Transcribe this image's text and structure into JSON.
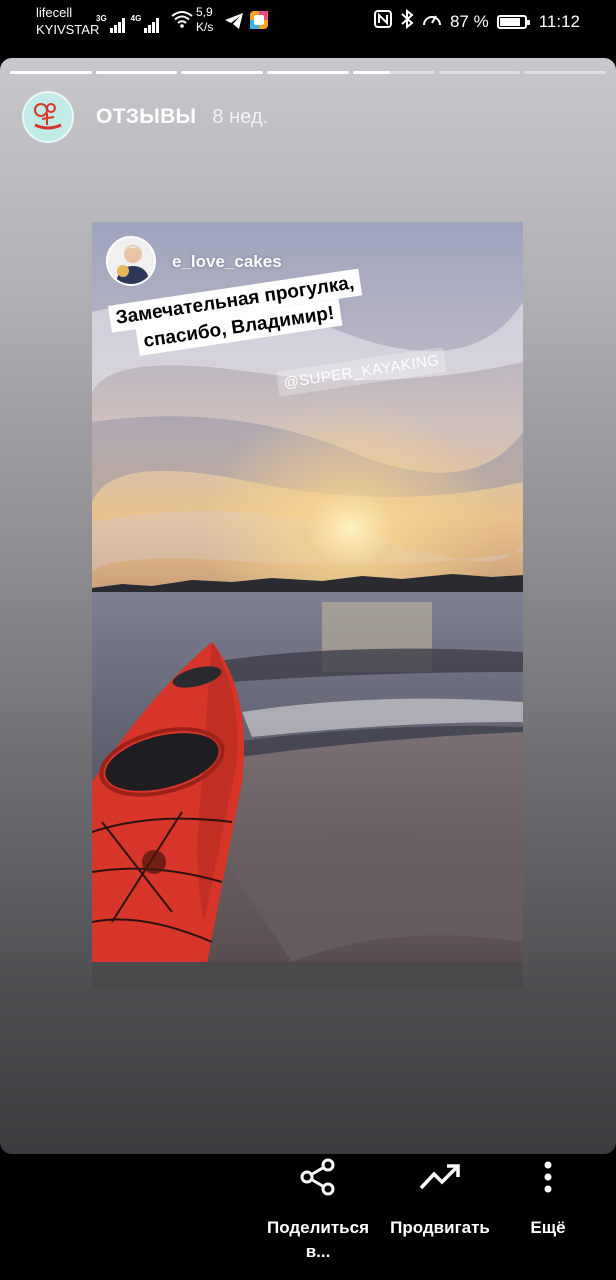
{
  "status_bar": {
    "carrier_line1": "lifecell",
    "carrier_line2": "KYIVSTAR",
    "net1": "3G",
    "net2": "4G",
    "speed_value": "5,9",
    "speed_unit": "K/s",
    "battery_percent": "87 %",
    "battery_level": 0.87,
    "time": "11:12"
  },
  "story": {
    "progress_segments": [
      1,
      1,
      1,
      1,
      0.45,
      0,
      0
    ],
    "highlight_title": "ОТЗЫВЫ",
    "time_ago": "8 нед.",
    "repost_username": "e_love_cakes",
    "caption_line1": "Замечательная прогулка,",
    "caption_line2": "спасибо, Владимир!",
    "mention": "@SUPER_KAYAKING"
  },
  "actions": {
    "share_line1": "Поделиться",
    "share_line2": "в...",
    "promote": "Продвигать",
    "more": "Ещё"
  },
  "colors": {
    "kayak": "#d8352a",
    "highlight_avatar_bg": "#c2ebe8"
  }
}
